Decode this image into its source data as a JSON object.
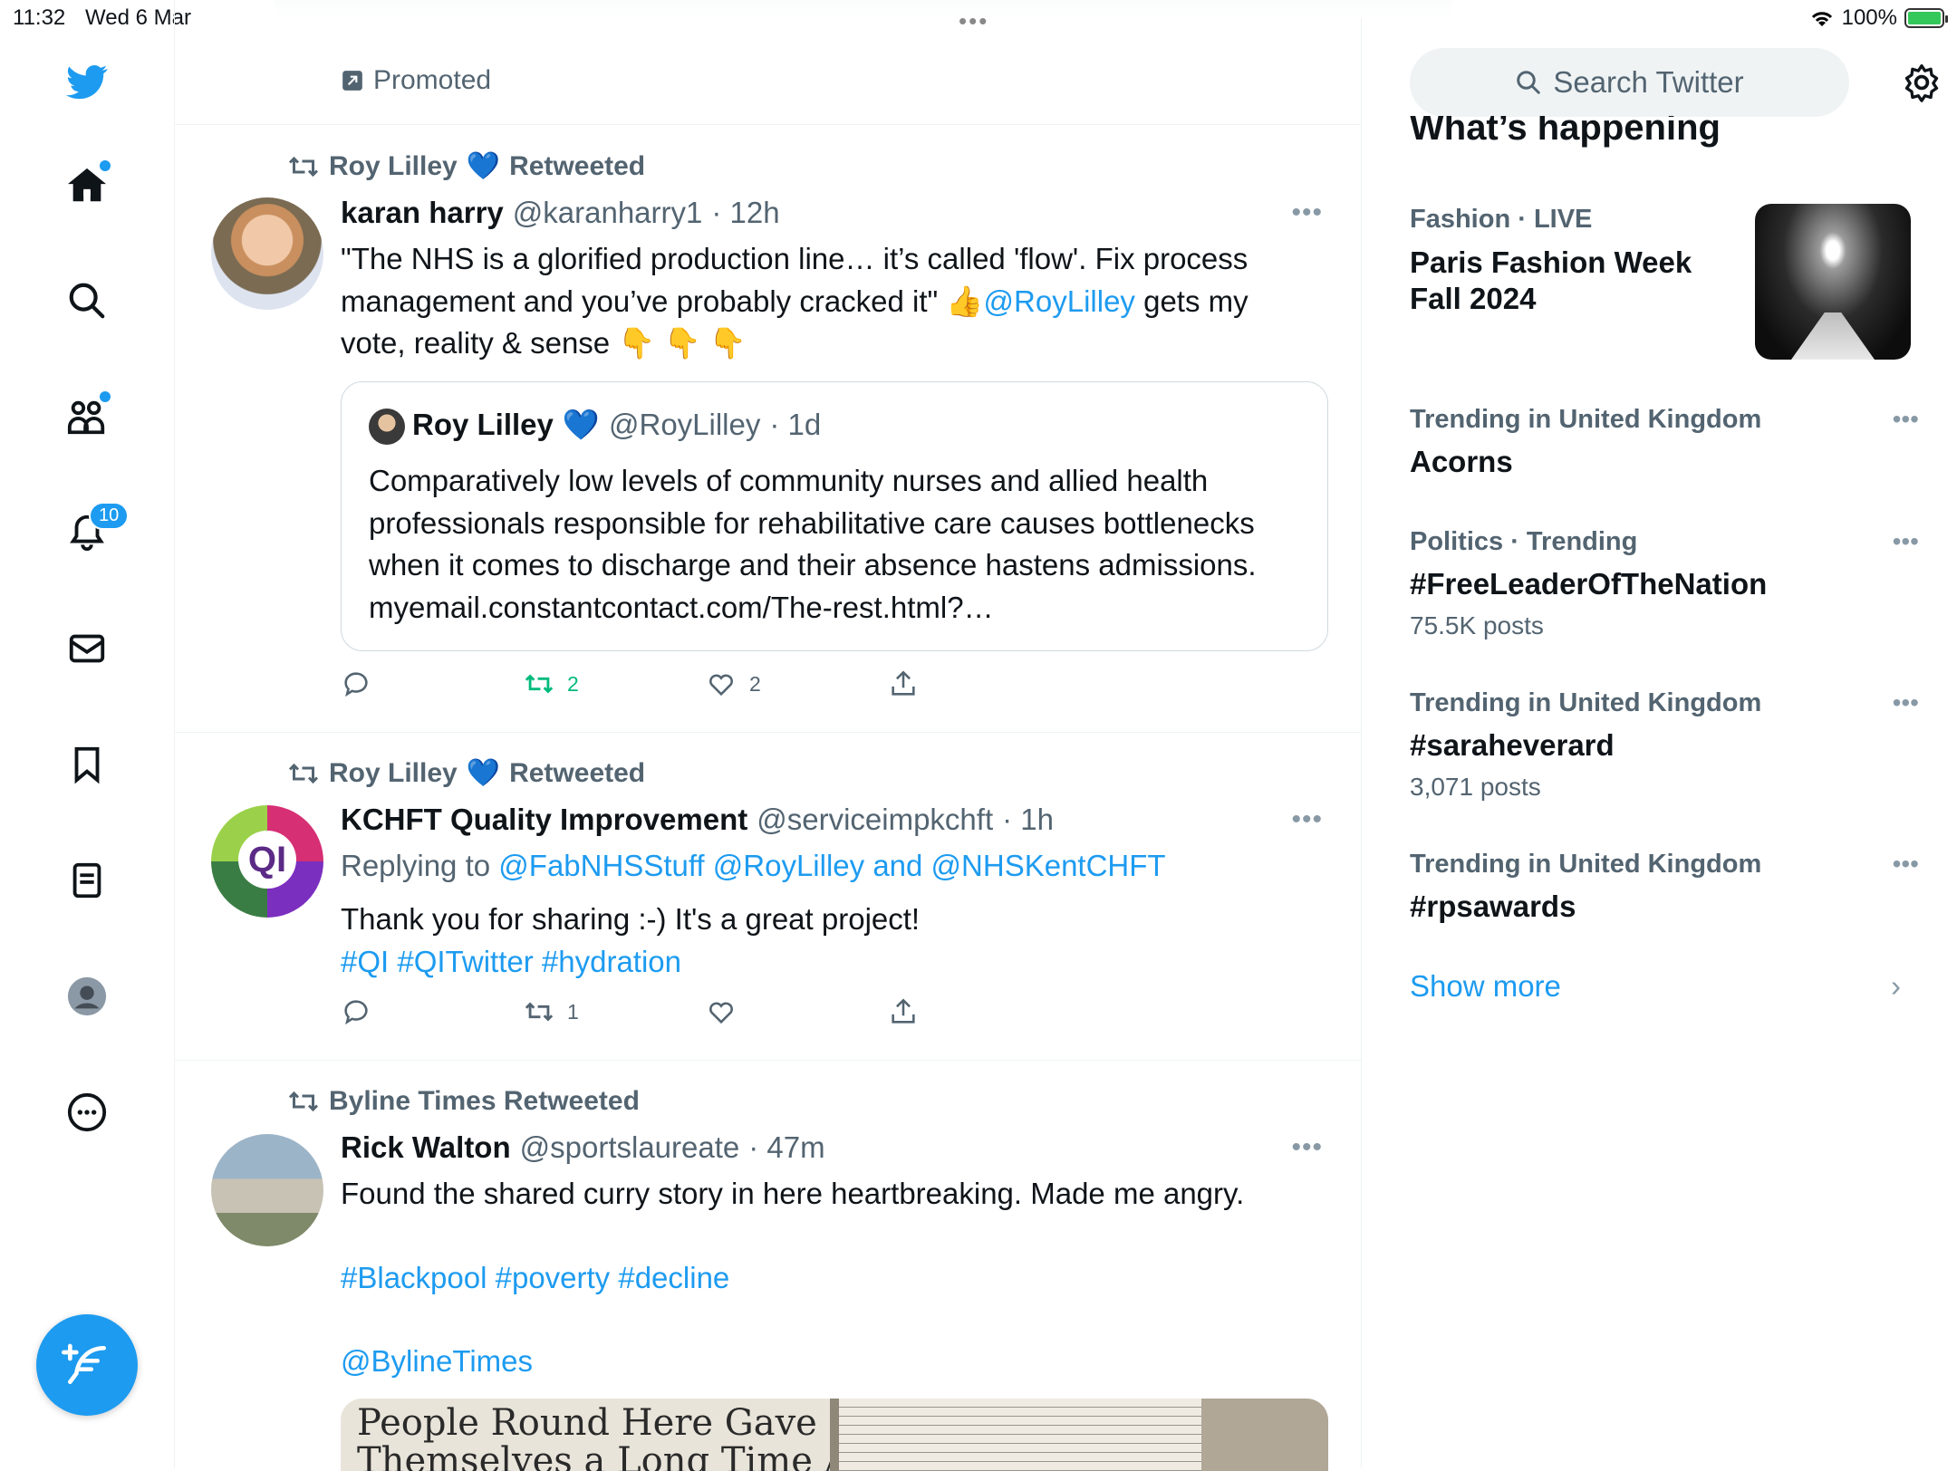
{
  "status_bar": {
    "time": "11:32",
    "date": "Wed 6 Mar",
    "battery": "100%"
  },
  "sidebar": {
    "items": [
      {
        "name": "home"
      },
      {
        "name": "explore"
      },
      {
        "name": "communities"
      },
      {
        "name": "notifications",
        "badge": "10"
      },
      {
        "name": "messages"
      },
      {
        "name": "bookmarks"
      },
      {
        "name": "lists"
      },
      {
        "name": "profile"
      },
      {
        "name": "more"
      }
    ]
  },
  "feed": {
    "promoted_label": "Promoted",
    "tweets": [
      {
        "retweeted_by": "Roy Lilley",
        "retweeted_emoji": "💙",
        "retweeted_suffix": "Retweeted",
        "name": "karan harry",
        "handle": "@karanharry1",
        "time": "· 12h",
        "text_line1": "\"The NHS is a glorified production line… it’s called 'flow'. Fix process",
        "text_line2a": "management and you’ve probably cracked it\" 👍",
        "text_mention": "@RoyLilley",
        "text_line2b": " gets my",
        "text_line3": "vote, reality & sense  👇 👇 👇",
        "quote": {
          "name": "Roy Lilley",
          "emoji": "💙",
          "handle": "@RoyLilley",
          "time": "· 1d",
          "text": "Comparatively low levels of community nurses and allied health professionals responsible for rehabilitative care causes bottlenecks when it comes to discharge and their absence hastens admissions. myemail.constantcontact.com/The-rest.html?…"
        },
        "retweets": "2",
        "likes": "2"
      },
      {
        "retweeted_by": "Roy Lilley",
        "retweeted_emoji": "💙",
        "retweeted_suffix": "Retweeted",
        "name": "KCHFT Quality Improvement",
        "handle": "@serviceimpkchft",
        "time": "· 1h",
        "replying_prefix": "Replying to",
        "replying_to": "@FabNHSStuff @RoyLilley and @NHSKentCHFT",
        "text": "Thank you for sharing :-) It's a great project!",
        "hashtags": "#QI #QITwitter #hydration",
        "retweets": "1"
      },
      {
        "retweeted_by": "Byline Times Retweeted",
        "name": "Rick Walton",
        "handle": "@sportslaureate",
        "time": "· 47m",
        "text": "Found the shared curry story in here heartbreaking. Made me angry.",
        "hashtags": "#Blackpool #poverty #decline",
        "mention": "@BylineTimes",
        "media_headline_1": "People Round Here Gave Up On",
        "media_headline_2": "Themselves a Long Time Ago’"
      }
    ]
  },
  "right_panel": {
    "search_placeholder": "Search Twitter",
    "heading": "What’s happening",
    "featured": {
      "meta": "Fashion · LIVE",
      "title_line1": "Paris Fashion Week",
      "title_line2": "Fall 2024"
    },
    "trends": [
      {
        "meta": "Trending in United Kingdom",
        "name": "Acorns",
        "count": ""
      },
      {
        "meta": "Politics · Trending",
        "name": "#FreeLeaderOfTheNation",
        "count": "75.5K posts"
      },
      {
        "meta": "Trending in United Kingdom",
        "name": "#saraheverard",
        "count": "3,071 posts"
      },
      {
        "meta": "Trending in United Kingdom",
        "name": "#rpsawards",
        "count": ""
      }
    ],
    "show_more": "Show more"
  },
  "colors": {
    "accent": "#1d9bf0",
    "retweet_green": "#00ba7c",
    "secondary_text": "#536471",
    "border": "#eff3f4"
  }
}
